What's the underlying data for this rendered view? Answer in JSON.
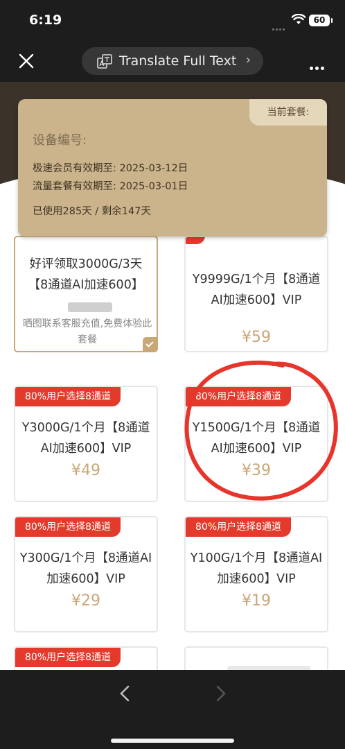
{
  "status_bar": {
    "time": "6:19",
    "battery": "60"
  },
  "nav": {
    "translate_label": "Translate Full Text",
    "translate_chevron": "›"
  },
  "member_card": {
    "plan_tag": "当前套餐:",
    "device_label": "设备编号:",
    "vip_expiry": "极速会员有效期至: 2025-03-12日",
    "data_expiry": "流量套餐有效期至: 2025-03-01日",
    "usage": "已使用285天 / 剩余147天"
  },
  "packages": [
    {
      "title": "好评领取3000G/3天\n【8通道AI加速600】",
      "description": "晒图联系客服充值,免费体验此套餐",
      "selected": true
    },
    {
      "title": "Y9999G/1个月【8通道AI加速600】VIP",
      "price": "¥59"
    },
    {
      "badge": "80%用户选择8通道",
      "title": "Y3000G/1个月【8通道AI加速600】VIP",
      "price": "¥49"
    },
    {
      "badge": "80%用户选择8通道",
      "title": "Y1500G/1个月【8通道AI加速600】VIP",
      "price": "¥39",
      "annotated": true
    },
    {
      "badge": "80%用户选择8通道",
      "title": "Y300G/1个月【8通道AI加速600】VIP",
      "price": "¥29"
    },
    {
      "badge": "80%用户选择8通道",
      "title": "Y100G/1个月【8通道AI加速600】VIP",
      "price": "¥19"
    },
    {
      "badge": "80%用户选择8通道"
    }
  ],
  "icons": {
    "close": "close-icon",
    "translate": "translate-icon",
    "more": "more-icon",
    "wifi": "wifi-icon",
    "battery": "battery-icon",
    "check": "check-icon",
    "back": "back-arrow-icon",
    "forward": "forward-arrow-icon"
  },
  "colors": {
    "accent_gold": "#c9a777",
    "badge_red": "#e33a2c",
    "card_gold": "#cbb48c",
    "annotation_red": "#e8352c"
  }
}
